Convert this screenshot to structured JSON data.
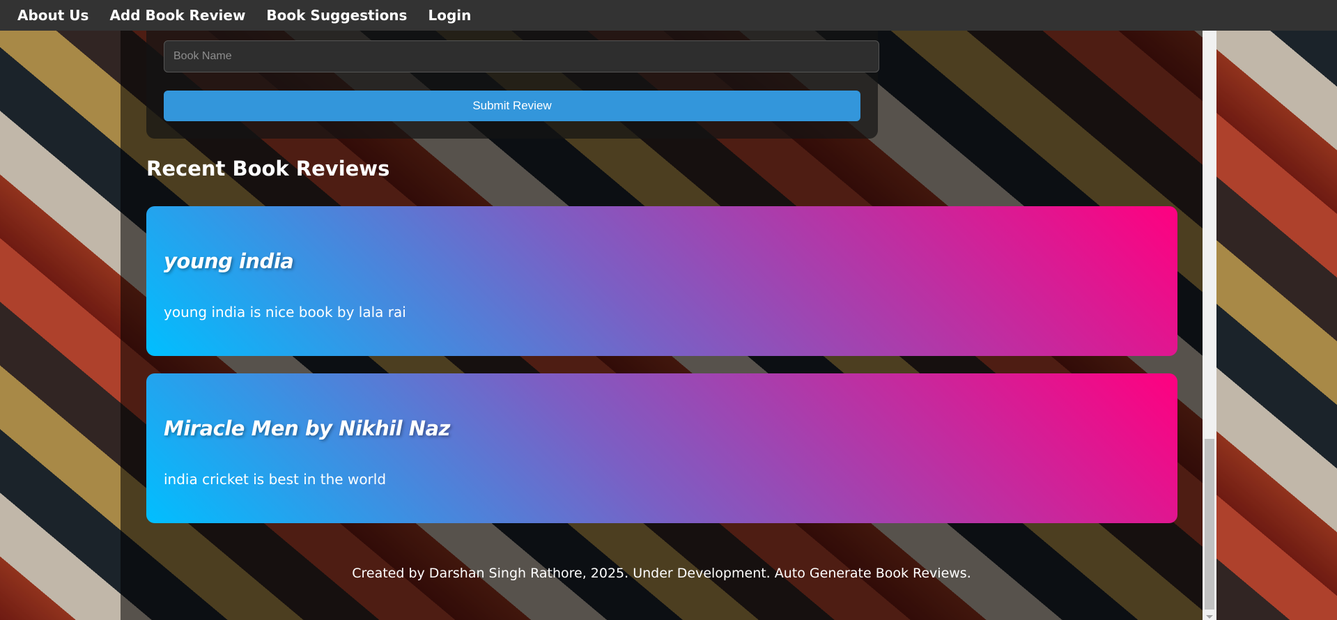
{
  "nav": {
    "items": [
      {
        "label": "About Us"
      },
      {
        "label": "Add Book Review"
      },
      {
        "label": "Book Suggestions"
      },
      {
        "label": "Login"
      }
    ]
  },
  "form": {
    "book_name_placeholder": "Book Name",
    "book_name_value": "",
    "submit_label": "Submit Review"
  },
  "reviews_section": {
    "title": "Recent Book Reviews",
    "reviews": [
      {
        "title": "young india",
        "text": "young india is nice book by lala rai"
      },
      {
        "title": "Miracle Men by Nikhil Naz",
        "text": "india cricket is best in the world"
      }
    ]
  },
  "footer": {
    "text": "Created by Darshan Singh Rathore, 2025. Under Development. Auto Generate Book Reviews."
  },
  "colors": {
    "navbar": "#333333",
    "button": "#3396db",
    "card_gradient_start": "#00bfff",
    "card_gradient_end": "#ff0080"
  }
}
